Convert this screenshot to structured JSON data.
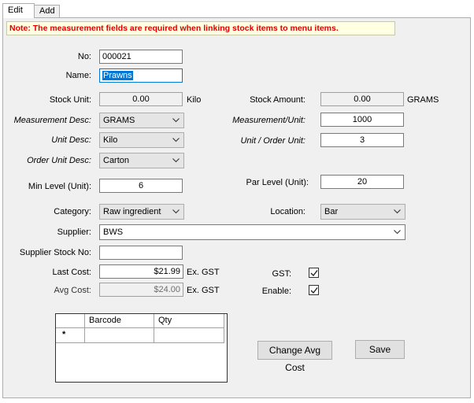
{
  "tabs": [
    {
      "label": "Edit"
    },
    {
      "label": "Add"
    }
  ],
  "note": "Note: The measurement fields are required when linking stock items to menu items.",
  "form": {
    "no": {
      "label": "No:",
      "value": "000021"
    },
    "name": {
      "label": "Name:",
      "value": "Prawns"
    },
    "stock_unit": {
      "label": "Stock Unit:",
      "value": "0.00",
      "unit": "Kilo"
    },
    "stock_amount": {
      "label": "Stock Amount:",
      "value": "0.00",
      "unit": "GRAMS"
    },
    "measurement_desc": {
      "label": "Measurement Desc:",
      "value": "GRAMS"
    },
    "measurement_unit": {
      "label": "Measurement/Unit:",
      "value": "1000"
    },
    "unit_desc": {
      "label": "Unit Desc:",
      "value": "Kilo"
    },
    "unit_order_unit": {
      "label": "Unit / Order Unit:",
      "value": "3"
    },
    "order_unit_desc": {
      "label": "Order Unit Desc:",
      "value": "Carton"
    },
    "min_level": {
      "label": "Min Level (Unit):",
      "value": "6"
    },
    "par_level": {
      "label": "Par Level (Unit):",
      "value": "20"
    },
    "category": {
      "label": "Category:",
      "value": "Raw ingredient"
    },
    "location": {
      "label": "Location:",
      "value": "Bar"
    },
    "supplier": {
      "label": "Supplier:",
      "value": "BWS"
    },
    "supplier_stock_no": {
      "label": "Supplier Stock No:",
      "value": ""
    },
    "last_cost": {
      "label": "Last Cost:",
      "value": "$21.99",
      "suffix": "Ex. GST"
    },
    "avg_cost": {
      "label": "Avg Cost:",
      "value": "$24.00",
      "suffix": "Ex. GST"
    },
    "gst": {
      "label": "GST:",
      "checked": true
    },
    "enable": {
      "label": "Enable:",
      "checked": true
    }
  },
  "grid": {
    "columns": [
      "Barcode",
      "Qty"
    ],
    "new_row_marker": "*"
  },
  "buttons": {
    "change_avg_cost": "Change Avg Cost",
    "save": "Save"
  },
  "colors": {
    "note_text": "#e00000",
    "note_bg": "#ffffe1",
    "focus_border": "#0078d7",
    "panel_bg": "#f0f0f0"
  }
}
